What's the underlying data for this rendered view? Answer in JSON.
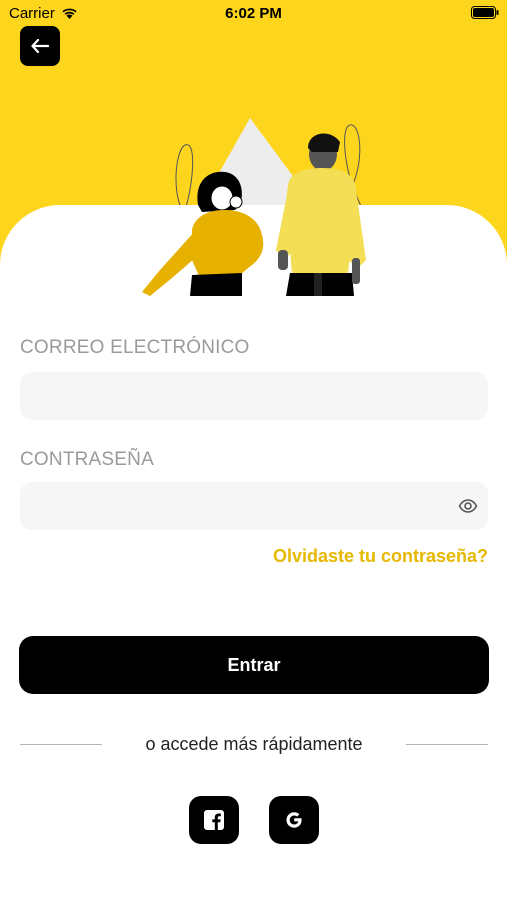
{
  "status_bar": {
    "carrier": "Carrier",
    "time": "6:02 PM"
  },
  "colors": {
    "accent_yellow": "#FDD51C",
    "link_yellow": "#E6B800",
    "primary_button": "#000000",
    "field_background": "#F6F6F6",
    "label_gray": "#9A9A9A"
  },
  "header": {
    "back_icon": "arrow-left-icon",
    "illustration": "two-people-illustration"
  },
  "form": {
    "email": {
      "label": "CORREO ELECTRÓNICO",
      "value": "",
      "placeholder": ""
    },
    "password": {
      "label": "CONTRASEÑA",
      "value": "",
      "placeholder": "",
      "toggle_icon": "eye-icon"
    },
    "forgot_password": "Olvidaste tu contraseña?",
    "submit_label": "Entrar"
  },
  "social": {
    "divider_text": "o accede más rápidamente",
    "facebook_icon": "facebook-icon",
    "google_icon": "google-icon"
  }
}
